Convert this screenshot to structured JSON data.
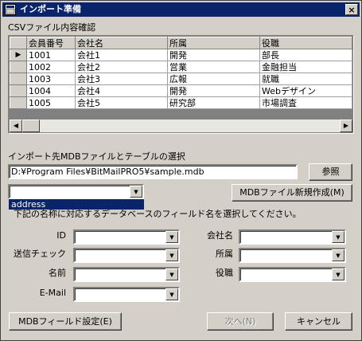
{
  "window": {
    "title": "インポート準備",
    "close_glyph": "×"
  },
  "csv_section": {
    "label": "CSVファイル内容確認"
  },
  "grid": {
    "columns": [
      "会員番号",
      "会社名",
      "所属",
      "役職"
    ],
    "rows": [
      [
        "1001",
        "会社1",
        "開発",
        "部長"
      ],
      [
        "1002",
        "会社2",
        "営業",
        "金融担当"
      ],
      [
        "1003",
        "会社3",
        "広報",
        "就職"
      ],
      [
        "1004",
        "会社4",
        "開発",
        "Webデザイン"
      ],
      [
        "1005",
        "会社5",
        "研究部",
        "市場調査"
      ]
    ],
    "current_row_marker": "▶"
  },
  "mdb_section": {
    "label": "インポート先MDBファイルとテーブルの選択",
    "path_value": "D:¥Program Files¥BitMailPRO5¥sample.mdb",
    "browse_label": "参照",
    "table_combo_value": "",
    "new_mdb_label": "MDBファイル新規作成(M)",
    "dropdown_option": "address",
    "instruction_visible": "下記の名称に対応するデータベースのフィールド名を選択してください。"
  },
  "fields": {
    "left": [
      {
        "label": "ID",
        "value": ""
      },
      {
        "label": "送信チェック",
        "value": ""
      },
      {
        "label": "名前",
        "value": ""
      },
      {
        "label": "E-Mail",
        "value": ""
      }
    ],
    "right": [
      {
        "label": "会社名",
        "value": ""
      },
      {
        "label": "所属",
        "value": ""
      },
      {
        "label": "役職",
        "value": ""
      }
    ]
  },
  "buttons": {
    "mdb_field_settings": "MDBフィールド設定(E)",
    "next": "次へ(N)",
    "cancel": "キャンセル"
  },
  "icons": {
    "app": "window-app-icon",
    "combo_arrow": "▼",
    "scroll_left": "◀",
    "scroll_right": "▶"
  }
}
